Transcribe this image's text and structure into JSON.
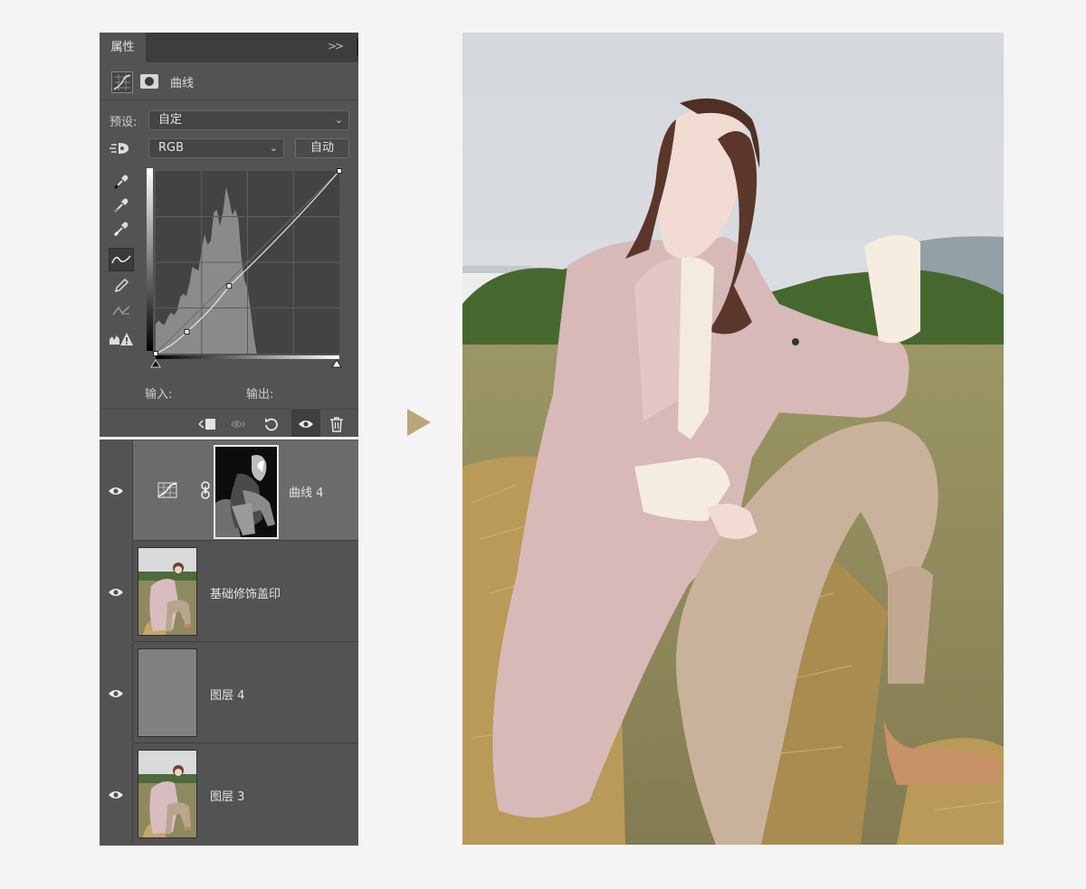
{
  "panel": {
    "tab_label": "属性",
    "collapse_glyph": ">>",
    "adjustment_title": "曲线",
    "preset_label": "预设:",
    "preset_value": "自定",
    "channel_value": "RGB",
    "auto_label": "自动",
    "input_label": "输入:",
    "output_label": "输出:"
  },
  "layers": [
    {
      "name": "曲线 4",
      "type": "curves-adjustment",
      "visible": true,
      "selected": true
    },
    {
      "name": "基础修饰盖印",
      "type": "photo",
      "visible": true,
      "selected": false
    },
    {
      "name": "图层 4",
      "type": "gray-fill",
      "visible": true,
      "selected": false
    },
    {
      "name": "图层 3",
      "type": "photo",
      "visible": true,
      "selected": false
    }
  ],
  "icons": [
    "curves-icon",
    "mask-icon",
    "target-adjust-icon",
    "black-point-eyedropper-icon",
    "gray-point-eyedropper-icon",
    "white-point-eyedropper-icon",
    "curve-point-tool-icon",
    "pencil-icon",
    "smooth-icon",
    "clipping-warning-icon",
    "clip-to-layer-icon",
    "view-previous-icon",
    "reset-icon",
    "visibility-icon",
    "trash-icon",
    "eye-icon",
    "link-icon"
  ],
  "colors": {
    "panel_bg": "#535353",
    "accent_arrow": "#b9a77c",
    "page_bg": "#f4f4f4"
  }
}
